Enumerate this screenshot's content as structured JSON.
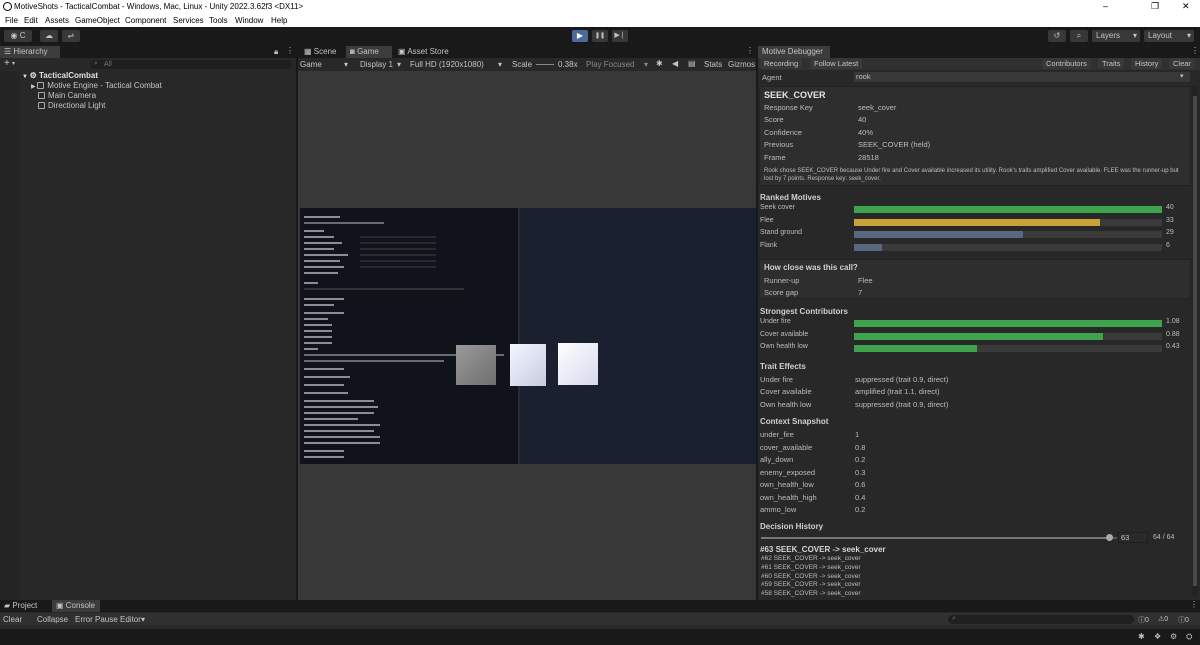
{
  "window": {
    "title": "MotiveShots - TacticalCombat - Windows, Mac, Linux - Unity 2022.3.62f3 <DX11>",
    "minimize": "–",
    "maximize": "❐",
    "close": "✕"
  },
  "menu": [
    "File",
    "Edit",
    "Assets",
    "GameObject",
    "Component",
    "Services",
    "Tools",
    "Window",
    "Help"
  ],
  "toolbar": {
    "account_label": "C",
    "layers_label": "Layers",
    "layout_label": "Layout",
    "play": "▶",
    "pause": "❚❚",
    "step": "▶❘"
  },
  "hierarchy": {
    "tab": "Hierarchy",
    "search_placeholder": "All",
    "add": "+",
    "scene": "TacticalCombat",
    "items": [
      "Motive Engine - Tactical Combat",
      "Main Camera",
      "Directional Light"
    ]
  },
  "game": {
    "tabs": [
      "Scene",
      "Game",
      "Asset Store"
    ],
    "mode": "Game",
    "display": "Display 1",
    "resolution": "Full HD (1920x1080)",
    "scale_label": "Scale",
    "scale_value": "0.38x",
    "play_focused": "Play Focused",
    "stats": "Stats",
    "gizmos": "Gizmos"
  },
  "debugger": {
    "tab": "Motive Debugger",
    "buttons_left": [
      "Recording",
      "Follow Latest"
    ],
    "buttons_right": [
      "Contributors",
      "Traits",
      "History",
      "Clear"
    ],
    "agent_label": "Agent",
    "agent_value": "rook",
    "decision": {
      "title": "SEEK_COVER",
      "rows": [
        {
          "label": "Response Key",
          "value": "seek_cover"
        },
        {
          "label": "Score",
          "value": "40"
        },
        {
          "label": "Confidence",
          "value": "40%"
        },
        {
          "label": "Previous",
          "value": "SEEK_COVER  (held)"
        },
        {
          "label": "Frame",
          "value": "28518"
        }
      ],
      "explanation": "Rook chose SEEK_COVER because Under fire and Cover available increased its utility. Rook's traits amplified Cover available. FLEE was the runner-up but lost by 7 points. Response key: seek_cover."
    },
    "ranked": {
      "title": "Ranked Motives",
      "items": [
        {
          "name": "Seek cover",
          "value": "40",
          "fill": 1.0,
          "color": "#3fa34d"
        },
        {
          "name": "Flee",
          "value": "33",
          "fill": 0.8,
          "color": "#c9a23a"
        },
        {
          "name": "Stand ground",
          "value": "29",
          "fill": 0.55,
          "color": "#5a6780"
        },
        {
          "name": "Flank",
          "value": "6",
          "fill": 0.09,
          "color": "#5a6780"
        }
      ]
    },
    "close_call": {
      "title": "How close was this call?",
      "rows": [
        {
          "label": "Runner-up",
          "value": "Flee"
        },
        {
          "label": "Score gap",
          "value": "7"
        }
      ]
    },
    "contributors": {
      "title": "Strongest Contributors",
      "items": [
        {
          "name": "Under fire",
          "value": "1.08",
          "fill": 1.0,
          "color": "#3fa34d"
        },
        {
          "name": "Cover available",
          "value": "0.88",
          "fill": 0.81,
          "color": "#3fa34d"
        },
        {
          "name": "Own health low",
          "value": "0.43",
          "fill": 0.4,
          "color": "#3fa34d"
        }
      ]
    },
    "traits": {
      "title": "Trait Effects",
      "rows": [
        {
          "label": "Under fire",
          "value": "suppressed   (trait 0.9, direct)"
        },
        {
          "label": "Cover available",
          "value": "amplified   (trait 1.1, direct)"
        },
        {
          "label": "Own health low",
          "value": "suppressed   (trait 0.9, direct)"
        }
      ]
    },
    "context": {
      "title": "Context Snapshot",
      "rows": [
        {
          "label": "under_fire",
          "value": "1"
        },
        {
          "label": "cover_available",
          "value": "0.8"
        },
        {
          "label": "ally_down",
          "value": "0.2"
        },
        {
          "label": "enemy_exposed",
          "value": "0.3"
        },
        {
          "label": "own_health_low",
          "value": "0.6"
        },
        {
          "label": "own_health_high",
          "value": "0.4"
        },
        {
          "label": "ammo_low",
          "value": "0.2"
        }
      ]
    },
    "history": {
      "title": "Decision History",
      "slider_value": "63",
      "slider_fill": 0.98,
      "count": "64 / 64",
      "current": "#63   SEEK_COVER   -> seek_cover",
      "lines": [
        "#62   SEEK_COVER   -> seek_cover",
        "#61   SEEK_COVER   -> seek_cover",
        "#60   SEEK_COVER   -> seek_cover",
        "#59   SEEK_COVER   -> seek_cover",
        "#58   SEEK_COVER   -> seek_cover"
      ]
    }
  },
  "bottom": {
    "tabs": [
      "Project",
      "Console"
    ],
    "buttons": [
      "Clear",
      "Collapse",
      "Error Pause",
      "Editor"
    ],
    "counts": [
      "0",
      "0",
      "0"
    ]
  }
}
